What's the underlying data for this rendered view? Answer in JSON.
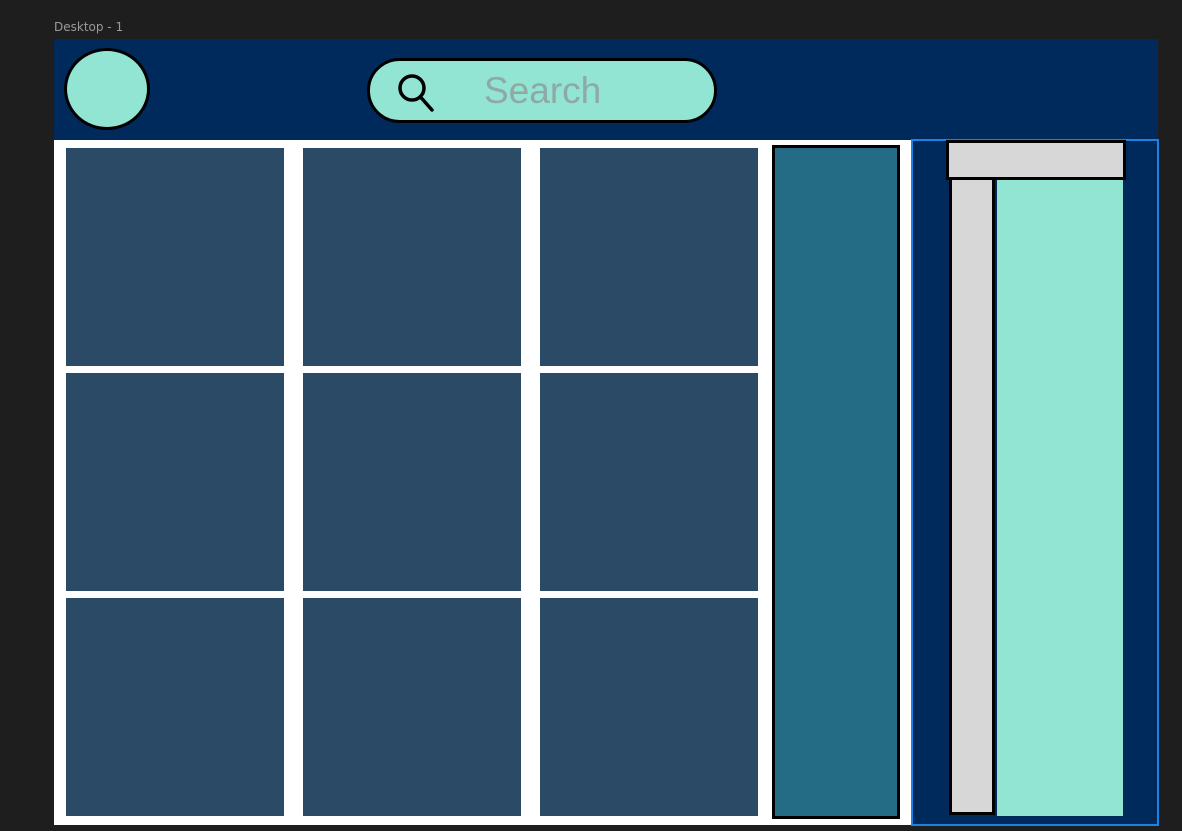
{
  "frame": {
    "label": "Desktop - 1"
  },
  "header": {
    "avatar_icon": "user-avatar-circle",
    "search": {
      "icon": "search-icon",
      "placeholder": "Search"
    }
  },
  "grid": {
    "rows": 3,
    "columns": 3
  },
  "colors": {
    "canvas": "#1e1e1e",
    "header": "#002a5c",
    "accent": "#92e4d3",
    "tile": "#2b4a66",
    "side_panel": "#246c85",
    "scrollbar": "#d7d7d7",
    "selection": "#1d83e2"
  }
}
